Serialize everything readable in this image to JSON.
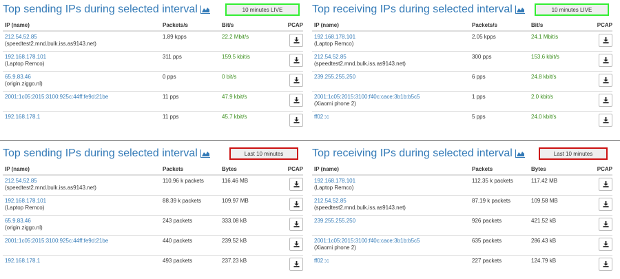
{
  "panels": [
    {
      "id": "tl",
      "title": "Top sending IPs during selected interval",
      "badge": "10 minutes LIVE",
      "badge_kind": "live",
      "headers": [
        "IP (name)",
        "Packets/s",
        "Bit/s",
        "PCAP"
      ],
      "rows": [
        {
          "ip": "212.54.52.85",
          "host": "(speedtest2.mnd.bulk.iss.as9143.net)",
          "v1": "1.89 kpps",
          "v2": "22.2 Mbit/s"
        },
        {
          "ip": "192.168.178.101",
          "host": "(Laptop Remco)",
          "v1": "311 pps",
          "v2": "159.5 kbit/s"
        },
        {
          "ip": "65.9.83.46",
          "host": "(origin.ziggo.nl)",
          "v1": "0 pps",
          "v2": "0 bit/s"
        },
        {
          "ip": "2001:1c05:2015:3100:925c:44ff:fe9d:21be",
          "host": "",
          "v1": "11 pps",
          "v2": "47.9 kbit/s"
        },
        {
          "ip": "192.168.178.1",
          "host": "",
          "v1": "11 pps",
          "v2": "45.7 kbit/s"
        }
      ]
    },
    {
      "id": "tr",
      "title": "Top receiving IPs during selected interval",
      "badge": "10 minutes LIVE",
      "badge_kind": "live",
      "headers": [
        "IP (name)",
        "Packets/s",
        "Bit/s",
        "PCAP"
      ],
      "rows": [
        {
          "ip": "192.168.178.101",
          "host": "(Laptop Remco)",
          "v1": "2.05 kpps",
          "v2": "24.1 Mbit/s"
        },
        {
          "ip": "212.54.52.85",
          "host": "(speedtest2.mnd.bulk.iss.as9143.net)",
          "v1": "300 pps",
          "v2": "153.6 kbit/s"
        },
        {
          "ip": "239.255.255.250",
          "host": "",
          "v1": "6 pps",
          "v2": "24.8 kbit/s"
        },
        {
          "ip": "2001:1c05:2015:3100:f40c:cace:3b1b:b5c5",
          "host": "(Xiaomi phone 2)",
          "v1": "1 pps",
          "v2": "2.0 kbit/s"
        },
        {
          "ip": "ff02::c",
          "host": "",
          "v1": "5 pps",
          "v2": "24.0 kbit/s"
        }
      ]
    },
    {
      "id": "bl",
      "title": "Top sending IPs during selected interval",
      "badge": "Last 10 minutes",
      "badge_kind": "last",
      "headers": [
        "IP (name)",
        "Packets",
        "Bytes",
        "PCAP"
      ],
      "rows": [
        {
          "ip": "212.54.52.85",
          "host": "(speedtest2.mnd.bulk.iss.as9143.net)",
          "v1": "110.96 k packets",
          "v2": "116.46 MB"
        },
        {
          "ip": "192.168.178.101",
          "host": "(Laptop Remco)",
          "v1": "88.39 k packets",
          "v2": "109.97 MB"
        },
        {
          "ip": "65.9.83.46",
          "host": "(origin.ziggo.nl)",
          "v1": "243 packets",
          "v2": "333.08 kB"
        },
        {
          "ip": "2001:1c05:2015:3100:925c:44ff:fe9d:21be",
          "host": "",
          "v1": "440 packets",
          "v2": "239.52 kB"
        },
        {
          "ip": "192.168.178.1",
          "host": "",
          "v1": "493 packets",
          "v2": "237.23 kB"
        }
      ]
    },
    {
      "id": "br",
      "title": "Top receiving IPs during selected interval",
      "badge": "Last 10 minutes",
      "badge_kind": "last",
      "headers": [
        "IP (name)",
        "Packets",
        "Bytes",
        "PCAP"
      ],
      "rows": [
        {
          "ip": "192.168.178.101",
          "host": "(Laptop Remco)",
          "v1": "112.35 k packets",
          "v2": "117.42 MB"
        },
        {
          "ip": "212.54.52.85",
          "host": "(speedtest2.mnd.bulk.iss.as9143.net)",
          "v1": "87.19 k packets",
          "v2": "109.58 MB"
        },
        {
          "ip": "239.255.255.250",
          "host": "",
          "v1": "926 packets",
          "v2": "421.52 kB"
        },
        {
          "ip": "2001:1c05:2015:3100:f40c:cace:3b1b:b5c5",
          "host": "(Xiaomi phone 2)",
          "v1": "635 packets",
          "v2": "286.43 kB"
        },
        {
          "ip": "ff02::c",
          "host": "",
          "v1": "227 packets",
          "v2": "124.79 kB"
        }
      ]
    }
  ],
  "icons": {
    "chart": "area-chart-icon",
    "download": "download-icon"
  },
  "colors": {
    "link": "#337ab7",
    "rate": "#3a8e1c",
    "live_border": "#33ee33",
    "last_border": "#cc1111"
  }
}
